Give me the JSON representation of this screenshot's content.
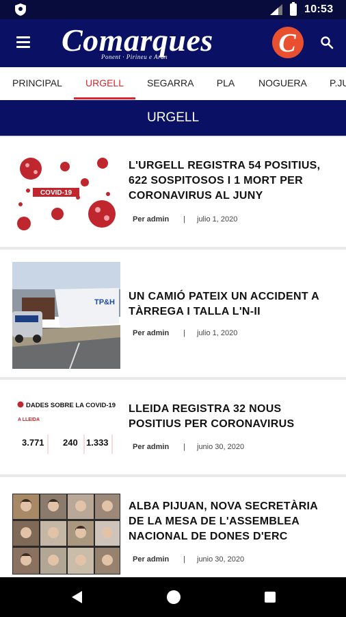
{
  "status_bar": {
    "time": "10:53",
    "icons": [
      "shield-icon",
      "signal-icon",
      "battery-icon"
    ]
  },
  "header": {
    "logo_text": "Comarques",
    "logo_tagline": "Ponent · Pirineu e Aran",
    "logo_badge_letter": "C",
    "menu_icon": "hamburger-menu-icon",
    "search_icon": "search-icon"
  },
  "tabs": [
    {
      "label": "PRINCIPAL",
      "active": false
    },
    {
      "label": "URGELL",
      "active": true
    },
    {
      "label": "SEGARRA",
      "active": false
    },
    {
      "label": "PLA",
      "active": false
    },
    {
      "label": "NOGUERA",
      "active": false
    },
    {
      "label": "P.JU",
      "active": false
    }
  ],
  "section_title": "URGELL",
  "articles": [
    {
      "title": "L'URGELL REGISTRA 54 POSITIUS, 622 SOSPITOSOS I 1 MORT PER CORONAVIRUS AL JUNY",
      "author": "Per admin",
      "date": "julio 1, 2020",
      "image_text": "COVID-19"
    },
    {
      "title": "UN CAMIÓ PATEIX UN ACCIDENT A TÀRREGA I TALLA L'N-II",
      "author": "Per admin",
      "date": "julio 1, 2020",
      "image_text": "TP&H"
    },
    {
      "title": "LLEIDA REGISTRA 32 NOUS POSITIUS PER CORONAVIRUS",
      "author": "Per admin",
      "date": "junio 30, 2020",
      "image_title": "DADES SOBRE LA COVID-19",
      "image_subtitle": "A LLEIDA",
      "image_numbers": [
        "3.771",
        "240",
        "1.333"
      ]
    },
    {
      "title": "ALBA PIJUAN, NOVA SECRETÀRIA DE LA MESA DE L'ASSEMBLEA NACIONAL DE DONES D'ERC",
      "author": "Per admin",
      "date": "junio 30, 2020"
    }
  ],
  "colors": {
    "brand_navy": "#0a1165",
    "status_navy": "#070c3d",
    "accent_red": "#d8262c",
    "badge_red": "#e8502f"
  },
  "nav_bar": [
    "back-icon",
    "home-icon",
    "recents-icon"
  ]
}
